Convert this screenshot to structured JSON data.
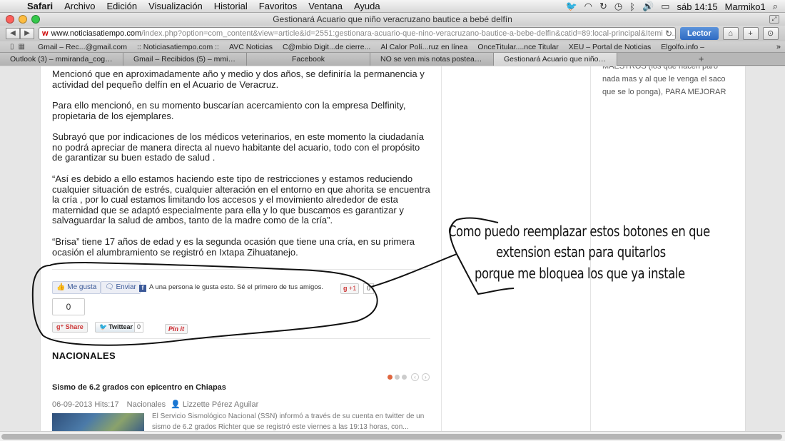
{
  "menubar": {
    "app": "Safari",
    "items": [
      "Archivo",
      "Edición",
      "Visualización",
      "Historial",
      "Favoritos",
      "Ventana",
      "Ayuda"
    ],
    "clock": "sáb 14:15",
    "user": "Marmiko1"
  },
  "window": {
    "title": "Gestionará Acuario que niño veracruzano bautice a bebé delfín"
  },
  "toolbar": {
    "url_host": "www.noticiasatiempo.com",
    "url_path": "/index.php?option=com_content&view=article&id=2551:gestionara-acuario-que-nino-veracruzano-bautice-a-bebe-delfin&catid=89:local-principal&Itemid=...",
    "reader_label": "Lector"
  },
  "bookmarks": [
    "Gmail – Rec...@gmail.com",
    ":: Noticiasatiempo.com ::",
    "AVC Noticias",
    "C@mbio Digit...de cierre...",
    "Al Calor Polí...ruz en línea",
    "OnceTitular....nce Titular",
    "XEU – Portal de Noticias",
    "Elgolfo.info –"
  ],
  "tabs": [
    {
      "label": "Outlook (3) – mmiranda_cogco@hot...",
      "active": false
    },
    {
      "label": "Gmail – Recibidos (5) – mmirandaco...",
      "active": false
    },
    {
      "label": "Facebook",
      "active": false
    },
    {
      "label": "NO se ven mis notas posteadas des...",
      "active": false
    },
    {
      "label": "Gestionará Acuario que niño veracr...",
      "active": true
    }
  ],
  "article": {
    "paragraphs": [
      "Mencionó que en aproximadamente año y medio y dos años, se definiría la permanencia y actividad del pequeño delfín en el Acuario de Veracruz.",
      "Para ello mencionó, en su momento buscarían acercamiento con la empresa Delfinity, propietaria de los ejemplares.",
      "Subrayó que por indicaciones de los médicos veterinarios, en este momento la ciudadanía no podrá apreciar de manera directa al nuevo habitante del acuario, todo con el propósito de garantizar su buen estado de salud .",
      "“Así es debido a ello estamos haciendo este tipo de restricciones y estamos reduciendo cualquier situación de estrés, cualquier alteración en el entorno en que ahorita se encuentra la cría , por lo cual estamos limitando los accesos y el movimiento alrededor de esta maternidad que se adaptó especialmente para ella y lo que buscamos es garantizar y salvaguardar la salud de ambos, tanto de la madre como de la cría”.",
      "“Brisa” tiene 17 años de edad y es la segunda ocasión que tiene una cría, en su primera ocasión el alumbramiento se registró en Ixtapa Zihuatanejo."
    ]
  },
  "share": {
    "like_label": "Me gusta",
    "send_label": "Enviar",
    "fb_social_text": "A una persona le gusta esto. Sé el primero de tus amigos.",
    "gplus_label": "+1",
    "gplus_count": "0",
    "count_box": "0",
    "gshare_label": "Share",
    "tweet_label": "Twittear",
    "tweet_count": "0",
    "pinit_label": "Pin it"
  },
  "nacionales": {
    "title": "NACIONALES",
    "news_title": "Sismo de 6.2 grados con epicentro en Chiapas",
    "date": "06-09-2013",
    "hits": "Hits:17",
    "category": "Nacionales",
    "author": "Lizzette Pérez Aguilar",
    "summary": "El Servicio Sismológico Nacional (SSN) informó a través de su cuenta en twitter de un sismo de 6.2 grados Richter que se registró este viernes a las 19:13 horas, con..."
  },
  "sidebar": {
    "text_lines": [
      "MAESTROS (los que hacen paro",
      "nada mas y al que le venga el saco",
      "que se lo ponga), PARA MEJORAR"
    ]
  },
  "annotation": {
    "lines": [
      "Como puedo reemplazar estos botones en que",
      "extension estan para quitarlos",
      "porque me bloquea los que ya instale"
    ]
  }
}
